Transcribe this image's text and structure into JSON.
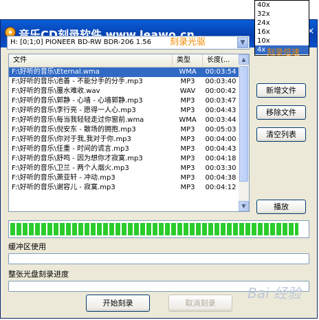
{
  "window": {
    "title": "音乐CD刻录软件 www.leawo.cn",
    "close_symbol": "×"
  },
  "drive": {
    "selected": "H:  [0;1;0] PIONEER  BD-RW   BDR-206  1.56",
    "annotation": "刻录光驱"
  },
  "speed": {
    "options": [
      "40x",
      "32x",
      "24x",
      "16x",
      "10x",
      "4x"
    ],
    "selected_option_index": 5,
    "current": "4x",
    "annotation": "刻录倍速"
  },
  "file_list": {
    "columns": [
      "文件",
      "类型",
      "长度(..."
    ],
    "selected_row_index": 0,
    "rows": [
      {
        "file": "F:\\好听的音乐\\Eternal.wma",
        "type": "WMA",
        "length": "00:03:54"
      },
      {
        "file": "F:\\好听的音乐\\池善 - 不能分手的分手.mp3",
        "type": "MP3",
        "length": "00:03:40"
      },
      {
        "file": "F:\\好听的音乐\\覆水难收.wav",
        "type": "WAV",
        "length": "00:00:42"
      },
      {
        "file": "F:\\好听的音乐\\郭静 - 心墙 - 心墙郭静.mp3",
        "type": "MP3",
        "length": "00:03:47"
      },
      {
        "file": "F:\\好听的音乐\\李行亮 - 愿得一人心.mp3",
        "type": "MP3",
        "length": "00:04:43"
      },
      {
        "file": "F:\\好听的音乐\\每当我轻轻走过你窗前.wma",
        "type": "WMA",
        "length": "00:03:44"
      },
      {
        "file": "F:\\好听的音乐\\倪安东 - 散场的拥抱.mp3",
        "type": "MP3",
        "length": "00:05:03"
      },
      {
        "file": "F:\\好听的音乐\\你对于我,我对于你.mp3",
        "type": "MP3",
        "length": "00:04:00"
      },
      {
        "file": "F:\\好听的音乐\\任重 - 时间的谎言.mp3",
        "type": "MP3",
        "length": "00:04:43"
      },
      {
        "file": "F:\\好听的音乐\\舒鸣 - 因为想你才寂寞.mp3",
        "type": "MP3",
        "length": "00:04:18"
      },
      {
        "file": "F:\\好听的音乐\\卫兰 - 两个人烟火.mp3",
        "type": "MP3",
        "length": "00:03:30"
      },
      {
        "file": "F:\\好听的音乐\\萧亚轩 - 冲动.mp3",
        "type": "MP3",
        "length": "00:04:38"
      },
      {
        "file": "F:\\好听的音乐\\谢容儿 - 寂寞.mp3",
        "type": "MP3",
        "length": "00:04:12"
      }
    ]
  },
  "buttons": {
    "add_file": "新增文件",
    "remove_file": "移除文件",
    "clear_list": "清空列表",
    "play": "播放",
    "start_burn": "开始刻录",
    "cancel_burn": "取消刻录"
  },
  "progress": {
    "main_fraction": 0.97
  },
  "labels": {
    "buffer_usage": "缓冲区使用",
    "disc_progress": "整张光盘刻录进度"
  },
  "watermark": "Bai 经验"
}
